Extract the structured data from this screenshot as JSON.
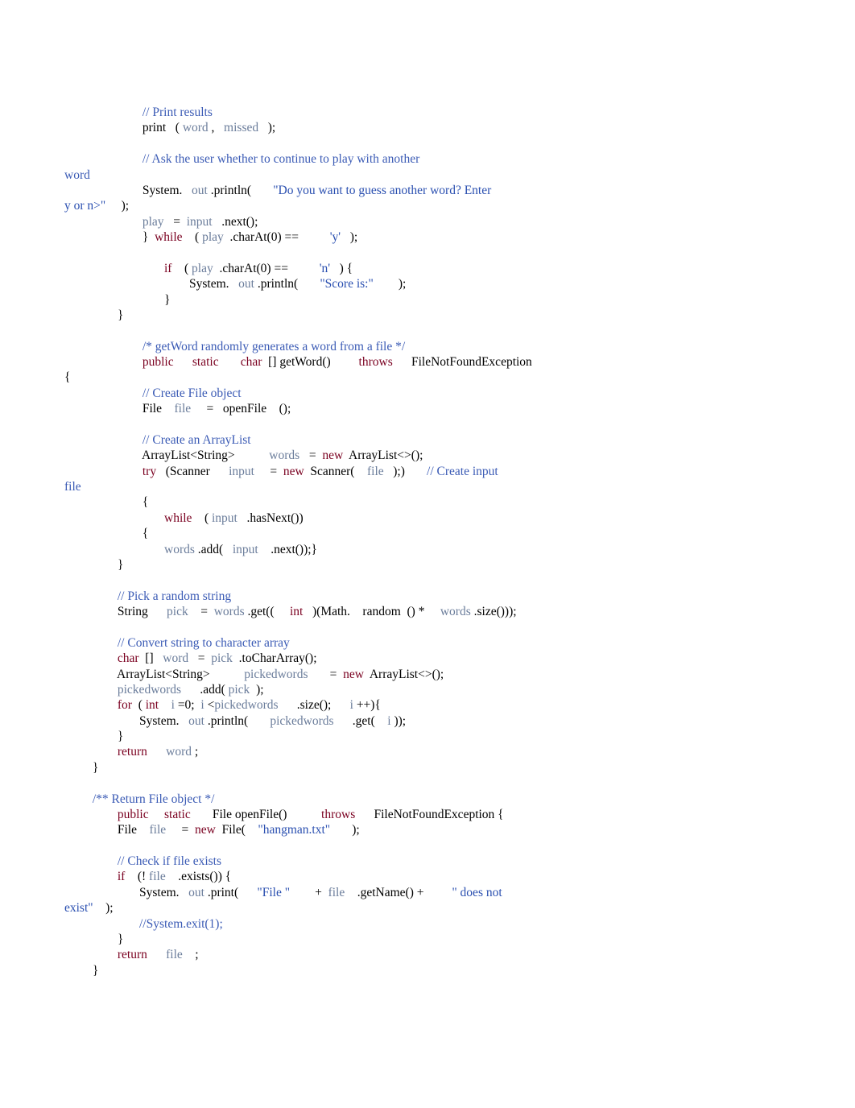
{
  "lines": [
    [
      [
        "",
        "                         "
      ],
      [
        "c",
        "// Print results"
      ]
    ],
    [
      [
        "",
        "                         "
      ],
      [
        "t",
        "print   ( "
      ],
      [
        "v",
        "word"
      ],
      [
        "t",
        " ,   "
      ],
      [
        "v",
        "missed"
      ],
      [
        "t",
        "   );"
      ]
    ],
    [
      [
        "",
        ""
      ]
    ],
    [
      [
        "",
        "                         "
      ],
      [
        "c",
        "// Ask the user whether to continue to play with another"
      ]
    ],
    [
      [
        "c",
        "word"
      ]
    ],
    [
      [
        "",
        "                         "
      ],
      [
        "t",
        "System.   "
      ],
      [
        "v",
        "out"
      ],
      [
        "t",
        " .println(       "
      ],
      [
        "s",
        "\"Do you want to guess another word? Enter"
      ]
    ],
    [
      [
        "s",
        "y or n>\""
      ],
      [
        "t",
        "     );"
      ]
    ],
    [
      [
        "",
        "                         "
      ],
      [
        "v",
        "play"
      ],
      [
        "t",
        "   =  "
      ],
      [
        "v",
        "input"
      ],
      [
        "t",
        "   .next();"
      ]
    ],
    [
      [
        "",
        "                         "
      ],
      [
        "t",
        "}  "
      ],
      [
        "k",
        "while"
      ],
      [
        "t",
        "    ( "
      ],
      [
        "v",
        "play"
      ],
      [
        "t",
        "  .charAt(0) ==          "
      ],
      [
        "s",
        "'y'"
      ],
      [
        "t",
        "   );"
      ]
    ],
    [
      [
        "",
        ""
      ]
    ],
    [
      [
        "",
        "                                "
      ],
      [
        "k",
        "if"
      ],
      [
        "t",
        "    ( "
      ],
      [
        "v",
        "play"
      ],
      [
        "t",
        "  .charAt(0) ==          "
      ],
      [
        "s",
        "'n'"
      ],
      [
        "t",
        "   ) {"
      ]
    ],
    [
      [
        "",
        "                                        "
      ],
      [
        "t",
        "System.   "
      ],
      [
        "v",
        "out"
      ],
      [
        "t",
        " .println(       "
      ],
      [
        "s",
        "\"Score is:\""
      ],
      [
        "t",
        "        );"
      ]
    ],
    [
      [
        "",
        "                                "
      ],
      [
        "t",
        "}"
      ]
    ],
    [
      [
        "",
        "                 "
      ],
      [
        "t",
        "}"
      ]
    ],
    [
      [
        "",
        ""
      ]
    ],
    [
      [
        "",
        "                         "
      ],
      [
        "c",
        "/* getWord randomly generates a word from a file */"
      ]
    ],
    [
      [
        "",
        "                         "
      ],
      [
        "k",
        "public"
      ],
      [
        "t",
        "      "
      ],
      [
        "k",
        "static"
      ],
      [
        "t",
        "       "
      ],
      [
        "k",
        "char"
      ],
      [
        "t",
        "  [] getWord()         "
      ],
      [
        "k",
        "throws"
      ],
      [
        "t",
        "      FileNotFoundException"
      ]
    ],
    [
      [
        "t",
        "{"
      ]
    ],
    [
      [
        "",
        "                         "
      ],
      [
        "c",
        "// Create File object"
      ]
    ],
    [
      [
        "",
        "                         "
      ],
      [
        "t",
        "File    "
      ],
      [
        "v",
        "file"
      ],
      [
        "t",
        "     =   openFile    ();"
      ]
    ],
    [
      [
        "",
        ""
      ]
    ],
    [
      [
        "",
        "                         "
      ],
      [
        "c",
        "// Create an ArrayList"
      ]
    ],
    [
      [
        "",
        "                         "
      ],
      [
        "t",
        "ArrayList<String>           "
      ],
      [
        "v",
        "words"
      ],
      [
        "t",
        "   =  "
      ],
      [
        "k",
        "new"
      ],
      [
        "t",
        "  ArrayList<>();"
      ]
    ],
    [
      [
        "",
        "                         "
      ],
      [
        "k",
        "try"
      ],
      [
        "t",
        "   (Scanner      "
      ],
      [
        "v",
        "input"
      ],
      [
        "t",
        "     =  "
      ],
      [
        "k",
        "new"
      ],
      [
        "t",
        "  Scanner(    "
      ],
      [
        "v",
        "file"
      ],
      [
        "t",
        "   );)       "
      ],
      [
        "c",
        "// Create input"
      ]
    ],
    [
      [
        "c",
        "file"
      ]
    ],
    [
      [
        "",
        "                         "
      ],
      [
        "t",
        "{"
      ]
    ],
    [
      [
        "",
        "                                "
      ],
      [
        "k",
        "while"
      ],
      [
        "t",
        "    ( "
      ],
      [
        "v",
        "input"
      ],
      [
        "t",
        "   .hasNext())"
      ]
    ],
    [
      [
        "",
        "                         "
      ],
      [
        "t",
        "{"
      ]
    ],
    [
      [
        "",
        "                                "
      ],
      [
        "v",
        "words"
      ],
      [
        "t",
        " .add(   "
      ],
      [
        "v",
        "input"
      ],
      [
        "t",
        "    .next());}"
      ]
    ],
    [
      [
        "",
        "                 "
      ],
      [
        "t",
        "}"
      ]
    ],
    [
      [
        "",
        ""
      ]
    ],
    [
      [
        "",
        "                 "
      ],
      [
        "c",
        "// Pick a random string"
      ]
    ],
    [
      [
        "",
        "                 "
      ],
      [
        "t",
        "String      "
      ],
      [
        "v",
        "pick"
      ],
      [
        "t",
        "    =  "
      ],
      [
        "v",
        "words"
      ],
      [
        "t",
        " .get((     "
      ],
      [
        "k",
        "int"
      ],
      [
        "t",
        "   )(Math.    random  () *     "
      ],
      [
        "v",
        "words"
      ],
      [
        "t",
        " .size()));"
      ]
    ],
    [
      [
        "",
        ""
      ]
    ],
    [
      [
        "",
        "                 "
      ],
      [
        "c",
        "// Convert string to character array"
      ]
    ],
    [
      [
        "",
        "                 "
      ],
      [
        "k",
        "char"
      ],
      [
        "t",
        "  []   "
      ],
      [
        "v",
        "word"
      ],
      [
        "t",
        "   =  "
      ],
      [
        "v",
        "pick"
      ],
      [
        "t",
        "  .toCharArray();"
      ]
    ],
    [
      [
        "",
        "                 "
      ],
      [
        "t",
        "ArrayList<String>           "
      ],
      [
        "v",
        "pickedwords"
      ],
      [
        "t",
        "       =  "
      ],
      [
        "k",
        "new"
      ],
      [
        "t",
        "  ArrayList<>();"
      ]
    ],
    [
      [
        "",
        "                 "
      ],
      [
        "v",
        "pickedwords"
      ],
      [
        "t",
        "      .add( "
      ],
      [
        "v",
        "pick"
      ],
      [
        "t",
        "  );"
      ]
    ],
    [
      [
        "",
        "                 "
      ],
      [
        "k",
        "for"
      ],
      [
        "t",
        "  ( "
      ],
      [
        "k",
        "int"
      ],
      [
        "t",
        "    "
      ],
      [
        "v",
        "i"
      ],
      [
        "t",
        " =0;  "
      ],
      [
        "v",
        "i"
      ],
      [
        "t",
        " <"
      ],
      [
        "v",
        "pickedwords"
      ],
      [
        "t",
        "      .size();      "
      ],
      [
        "v",
        "i"
      ],
      [
        "t",
        " ++){"
      ]
    ],
    [
      [
        "",
        "                        "
      ],
      [
        "t",
        "System.   "
      ],
      [
        "v",
        "out"
      ],
      [
        "t",
        " .println(       "
      ],
      [
        "v",
        "pickedwords"
      ],
      [
        "t",
        "      .get(    "
      ],
      [
        "v",
        "i"
      ],
      [
        "t",
        " ));"
      ]
    ],
    [
      [
        "",
        "                 "
      ],
      [
        "t",
        "}"
      ]
    ],
    [
      [
        "",
        "                 "
      ],
      [
        "k",
        "return"
      ],
      [
        "t",
        "      "
      ],
      [
        "v",
        "word"
      ],
      [
        "t",
        " ;"
      ]
    ],
    [
      [
        "",
        "         "
      ],
      [
        "t",
        "}"
      ]
    ],
    [
      [
        "",
        ""
      ]
    ],
    [
      [
        "",
        "         "
      ],
      [
        "c",
        "/** Return File object */"
      ]
    ],
    [
      [
        "",
        "                 "
      ],
      [
        "k",
        "public"
      ],
      [
        "t",
        "     "
      ],
      [
        "k",
        "static"
      ],
      [
        "t",
        "       File openFile()           "
      ],
      [
        "k",
        "throws"
      ],
      [
        "t",
        "      FileNotFoundException {"
      ]
    ],
    [
      [
        "",
        "                 "
      ],
      [
        "t",
        "File    "
      ],
      [
        "v",
        "file"
      ],
      [
        "t",
        "     =  "
      ],
      [
        "k",
        "new"
      ],
      [
        "t",
        "  File(    "
      ],
      [
        "s",
        "\"hangman.txt\""
      ],
      [
        "t",
        "       );"
      ]
    ],
    [
      [
        "",
        ""
      ]
    ],
    [
      [
        "",
        "                 "
      ],
      [
        "c",
        "// Check if file exists"
      ]
    ],
    [
      [
        "",
        "                 "
      ],
      [
        "k",
        "if"
      ],
      [
        "t",
        "    (! "
      ],
      [
        "v",
        "file"
      ],
      [
        "t",
        "    .exists()) {"
      ]
    ],
    [
      [
        "",
        "                        "
      ],
      [
        "t",
        "System.   "
      ],
      [
        "v",
        "out"
      ],
      [
        "t",
        " .print(      "
      ],
      [
        "s",
        "\"File \""
      ],
      [
        "t",
        "        +  "
      ],
      [
        "v",
        "file"
      ],
      [
        "t",
        "    .getName() +         "
      ],
      [
        "s",
        "\" does not"
      ]
    ],
    [
      [
        "s",
        "exist\""
      ],
      [
        "t",
        "    );"
      ]
    ],
    [
      [
        "",
        "                        "
      ],
      [
        "c",
        "//System.exit(1);"
      ]
    ],
    [
      [
        "",
        "                 "
      ],
      [
        "t",
        "}"
      ]
    ],
    [
      [
        "",
        "                 "
      ],
      [
        "k",
        "return"
      ],
      [
        "t",
        "      "
      ],
      [
        "v",
        "file"
      ],
      [
        "t",
        "    ;"
      ]
    ],
    [
      [
        "",
        "         "
      ],
      [
        "t",
        "}"
      ]
    ]
  ]
}
